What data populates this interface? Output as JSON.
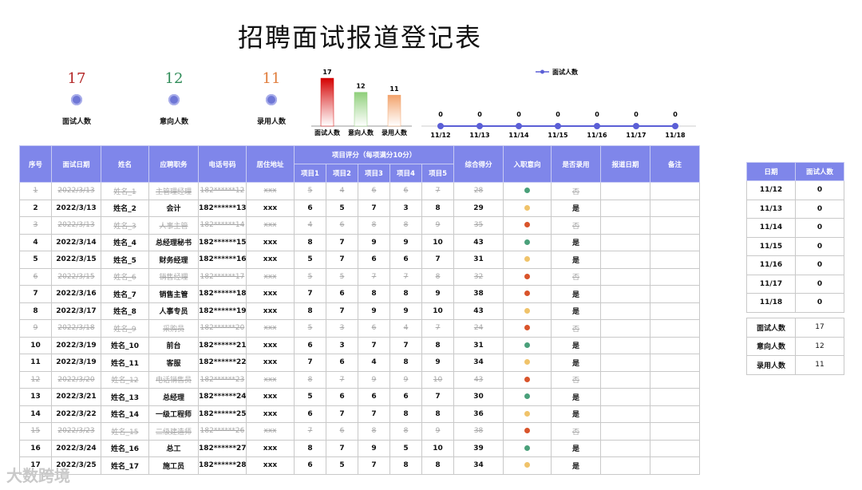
{
  "title": "招聘面试报道登记表",
  "kpis": [
    {
      "value": "17",
      "label": "面试人数",
      "color": "#b22222"
    },
    {
      "value": "12",
      "label": "意向人数",
      "color": "#2e8b57"
    },
    {
      "value": "11",
      "label": "录用人数",
      "color": "#e07b39"
    }
  ],
  "chart_data": [
    {
      "type": "bar",
      "categories": [
        "面试人数",
        "意向人数",
        "录用人数"
      ],
      "values": [
        17,
        12,
        11
      ],
      "colors": [
        "#d40000",
        "#8fcf7a",
        "#f2a26a"
      ]
    },
    {
      "type": "line",
      "legend": "面试人数",
      "x": [
        "11/12",
        "11/13",
        "11/14",
        "11/15",
        "11/16",
        "11/17",
        "11/18"
      ],
      "values": [
        0,
        0,
        0,
        0,
        0,
        0,
        0
      ],
      "color": "#5b5fd6"
    }
  ],
  "table": {
    "headers": {
      "seq": "序号",
      "date": "面试日期",
      "name": "姓名",
      "position": "应聘职务",
      "phone": "电话号码",
      "address": "居住地址",
      "score_group": "项目评分（每项满分10分）",
      "items": [
        "项目1",
        "项目2",
        "项目3",
        "项目4",
        "项目5"
      ],
      "total": "综合得分",
      "intent": "入职意向",
      "hired": "是否录用",
      "report_date": "报道日期",
      "notes": "备注"
    },
    "rows": [
      {
        "seq": "1",
        "date": "2022/3/13",
        "name": "姓名_1",
        "position": "主管理经理",
        "phone": "182******12",
        "addr": "xxx",
        "scores": [
          "5",
          "4",
          "6",
          "6",
          "7"
        ],
        "total": "28",
        "intent": "#4aa07a",
        "hired": "否",
        "struck": true
      },
      {
        "seq": "2",
        "date": "2022/3/13",
        "name": "姓名_2",
        "position": "会计",
        "phone": "182******13",
        "addr": "xxx",
        "scores": [
          "6",
          "5",
          "7",
          "3",
          "8"
        ],
        "total": "29",
        "intent": "#f0c36a",
        "hired": "是",
        "struck": false
      },
      {
        "seq": "3",
        "date": "2022/3/13",
        "name": "姓名_3",
        "position": "人事主管",
        "phone": "182******14",
        "addr": "xxx",
        "scores": [
          "4",
          "6",
          "8",
          "8",
          "9"
        ],
        "total": "35",
        "intent": "#d9542b",
        "hired": "否",
        "struck": true
      },
      {
        "seq": "4",
        "date": "2022/3/14",
        "name": "姓名_4",
        "position": "总经理秘书",
        "phone": "182******15",
        "addr": "xxx",
        "scores": [
          "8",
          "7",
          "9",
          "9",
          "10"
        ],
        "total": "43",
        "intent": "#4aa07a",
        "hired": "是",
        "struck": false
      },
      {
        "seq": "5",
        "date": "2022/3/15",
        "name": "姓名_5",
        "position": "财务经理",
        "phone": "182******16",
        "addr": "xxx",
        "scores": [
          "5",
          "7",
          "6",
          "6",
          "7"
        ],
        "total": "31",
        "intent": "#f0c36a",
        "hired": "是",
        "struck": false
      },
      {
        "seq": "6",
        "date": "2022/3/15",
        "name": "姓名_6",
        "position": "销售经理",
        "phone": "182******17",
        "addr": "xxx",
        "scores": [
          "5",
          "5",
          "7",
          "7",
          "8"
        ],
        "total": "32",
        "intent": "#d9542b",
        "hired": "否",
        "struck": true
      },
      {
        "seq": "7",
        "date": "2022/3/16",
        "name": "姓名_7",
        "position": "销售主管",
        "phone": "182******18",
        "addr": "xxx",
        "scores": [
          "7",
          "6",
          "8",
          "8",
          "9"
        ],
        "total": "38",
        "intent": "#d9542b",
        "hired": "是",
        "struck": false
      },
      {
        "seq": "8",
        "date": "2022/3/17",
        "name": "姓名_8",
        "position": "人事专员",
        "phone": "182******19",
        "addr": "xxx",
        "scores": [
          "8",
          "7",
          "9",
          "9",
          "10"
        ],
        "total": "43",
        "intent": "#f0c36a",
        "hired": "是",
        "struck": false
      },
      {
        "seq": "9",
        "date": "2022/3/18",
        "name": "姓名_9",
        "position": "采购员",
        "phone": "182******20",
        "addr": "xxx",
        "scores": [
          "5",
          "3",
          "6",
          "4",
          "7"
        ],
        "total": "24",
        "intent": "#d9542b",
        "hired": "否",
        "struck": true
      },
      {
        "seq": "10",
        "date": "2022/3/19",
        "name": "姓名_10",
        "position": "前台",
        "phone": "182******21",
        "addr": "xxx",
        "scores": [
          "6",
          "3",
          "7",
          "7",
          "8"
        ],
        "total": "31",
        "intent": "#4aa07a",
        "hired": "是",
        "struck": false
      },
      {
        "seq": "11",
        "date": "2022/3/19",
        "name": "姓名_11",
        "position": "客服",
        "phone": "182******22",
        "addr": "xxx",
        "scores": [
          "7",
          "6",
          "4",
          "8",
          "9"
        ],
        "total": "34",
        "intent": "#f0c36a",
        "hired": "是",
        "struck": false
      },
      {
        "seq": "12",
        "date": "2022/3/20",
        "name": "姓名_12",
        "position": "电话销售员",
        "phone": "182******23",
        "addr": "xxx",
        "scores": [
          "8",
          "7",
          "9",
          "9",
          "10"
        ],
        "total": "43",
        "intent": "#d9542b",
        "hired": "否",
        "struck": true
      },
      {
        "seq": "13",
        "date": "2022/3/21",
        "name": "姓名_13",
        "position": "总经理",
        "phone": "182******24",
        "addr": "xxx",
        "scores": [
          "5",
          "6",
          "6",
          "6",
          "7"
        ],
        "total": "30",
        "intent": "#4aa07a",
        "hired": "是",
        "struck": false
      },
      {
        "seq": "14",
        "date": "2022/3/22",
        "name": "姓名_14",
        "position": "一级工程师",
        "phone": "182******25",
        "addr": "xxx",
        "scores": [
          "6",
          "7",
          "7",
          "8",
          "8"
        ],
        "total": "36",
        "intent": "#f0c36a",
        "hired": "是",
        "struck": false
      },
      {
        "seq": "15",
        "date": "2022/3/23",
        "name": "姓名_15",
        "position": "二级建造师",
        "phone": "182******26",
        "addr": "xxx",
        "scores": [
          "7",
          "6",
          "8",
          "8",
          "9"
        ],
        "total": "38",
        "intent": "#d9542b",
        "hired": "否",
        "struck": true
      },
      {
        "seq": "16",
        "date": "2022/3/24",
        "name": "姓名_16",
        "position": "总工",
        "phone": "182******27",
        "addr": "xxx",
        "scores": [
          "8",
          "7",
          "9",
          "5",
          "10"
        ],
        "total": "39",
        "intent": "#4aa07a",
        "hired": "是",
        "struck": false
      },
      {
        "seq": "17",
        "date": "2022/3/25",
        "name": "姓名_17",
        "position": "施工员",
        "phone": "182******28",
        "addr": "xxx",
        "scores": [
          "6",
          "5",
          "7",
          "8",
          "8"
        ],
        "total": "34",
        "intent": "#f0c36a",
        "hired": "是",
        "struck": false
      }
    ]
  },
  "date_table": {
    "headers": [
      "日期",
      "面试人数"
    ],
    "rows": [
      [
        "11/12",
        "0"
      ],
      [
        "11/13",
        "0"
      ],
      [
        "11/14",
        "0"
      ],
      [
        "11/15",
        "0"
      ],
      [
        "11/16",
        "0"
      ],
      [
        "11/17",
        "0"
      ],
      [
        "11/18",
        "0"
      ]
    ]
  },
  "summary_table": {
    "rows": [
      [
        "面试人数",
        "17"
      ],
      [
        "意向人数",
        "12"
      ],
      [
        "录用人数",
        "11"
      ]
    ]
  },
  "watermark": "大数跨境"
}
